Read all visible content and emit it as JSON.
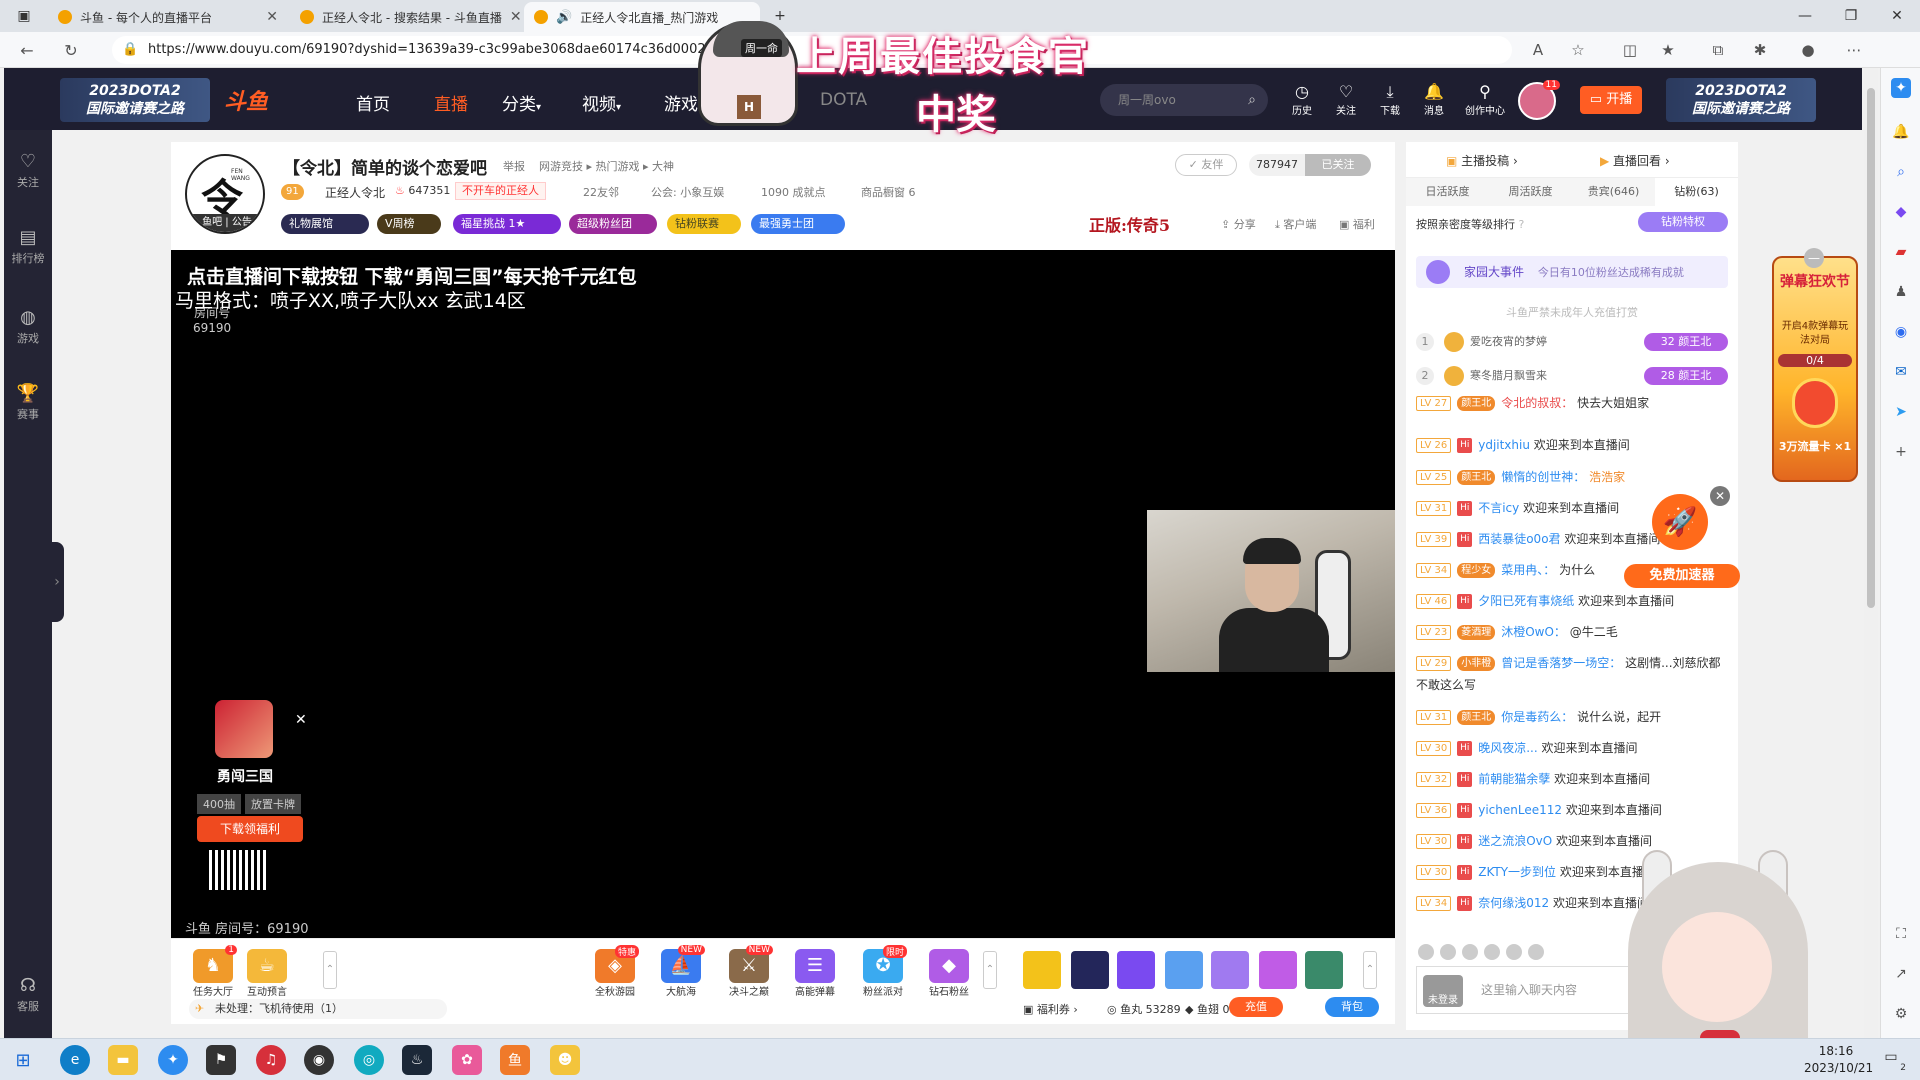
{
  "browser": {
    "tabs": [
      {
        "title": "斗鱼 - 每个人的直播平台",
        "active": false
      },
      {
        "title": "正经人令北 - 搜索结果 - 斗鱼直播",
        "active": false
      },
      {
        "title": "正经人令北直播_热门游戏",
        "active": true
      }
    ],
    "url": "https://www.douyu.com/69190?dyshid=13639a39-c3c99abe3068dae60174c36d0002160"
  },
  "promo": {
    "line1": "上周最佳投食官",
    "line2": "中奖",
    "badge": "周一命",
    "mark": "H"
  },
  "header": {
    "banner_left": [
      "2023DOTA2",
      "国际邀请赛之路"
    ],
    "banner_right": [
      "2023DOTA2",
      "国际邀请赛之路"
    ],
    "logo": "斗鱼",
    "nav": [
      "首页",
      "直播",
      "分类",
      "视频",
      "游戏",
      "DOTA"
    ],
    "search_placeholder": "周一周ovo",
    "icons": [
      {
        "icon": "history-icon",
        "label": "历史"
      },
      {
        "icon": "heart-icon",
        "label": "关注"
      },
      {
        "icon": "download-icon",
        "label": "下载"
      },
      {
        "icon": "bell-icon",
        "label": "消息"
      },
      {
        "icon": "bulb-icon",
        "label": "创作中心"
      }
    ],
    "avatar_badge": "11",
    "start_live": "开播"
  },
  "left_sidebar": [
    {
      "icon": "heart-icon",
      "label": "关注"
    },
    {
      "icon": "ranking-icon",
      "label": "排行榜"
    },
    {
      "icon": "game-icon",
      "label": "游戏"
    },
    {
      "icon": "trophy-icon",
      "label": "赛事"
    },
    {
      "icon": "service-icon",
      "label": "客服"
    }
  ],
  "room": {
    "avatar_char": "令王",
    "avatar_sub": "FEN WANG",
    "avatar_bar": "鱼吧 | 公告",
    "title": "【令北】简单的谈个恋爱吧",
    "report": "举报",
    "breadcrumb": "网游竞技 ▸ 热门游戏 ▸ 大神",
    "level": "91",
    "streamer": "正经人令北",
    "heat": "647351",
    "tagline": "不开车的正经人",
    "neighbors": "22友邻",
    "guild": "公会: 小象互娱",
    "achievements": "1090 成就点",
    "shop": "商品橱窗 6",
    "pills": [
      "礼物展馆",
      "V周榜",
      "福星挑战 1★",
      "超级粉丝团",
      "钻粉联赛",
      "最强勇士团"
    ],
    "right_brand": "正版:传奇5",
    "actions": [
      "分享",
      "客户端",
      "福利"
    ],
    "follow_btn": "✓ 友伴",
    "follow_count": "787947",
    "followed_btn": "已关注"
  },
  "video": {
    "banner": "点击直播间下载按钮 下载“勇闯三国”每天抢千元红包",
    "subtitle": "马里格式：喷子XX,喷子大队xx  玄武14区",
    "room_label": "房间号",
    "room_id": "69190",
    "bottom_tag": "斗鱼 房间号：69190",
    "ad": {
      "name": "勇闯三国",
      "tags": [
        "400抽",
        "放置卡牌"
      ],
      "download": "下载领福利"
    }
  },
  "toolbar": {
    "left_icons": [
      {
        "label": "任务大厅",
        "badge": "1",
        "color": "#f09a2a"
      },
      {
        "label": "互动预言",
        "badge": "",
        "color": "#f4b83a"
      }
    ],
    "mid_icons": [
      {
        "label": "全秋游园",
        "badge": "特惠",
        "color": "#f07a2a"
      },
      {
        "label": "大航海",
        "badge": "NEW",
        "color": "#3a7bf0"
      },
      {
        "label": "决斗之巅",
        "badge": "NEW",
        "color": "#8a6a4a"
      },
      {
        "label": "高能弹幕",
        "badge": "",
        "color": "#8a5af0"
      },
      {
        "label": "粉丝派对",
        "badge": "限时",
        "color": "#3aaaf0"
      },
      {
        "label": "钻石粉丝",
        "badge": "",
        "color": "#b05ce6"
      }
    ],
    "notice": "未处理：飞机待使用（1）",
    "welfare": "福利券",
    "fishball": "鱼丸 53289",
    "fishfin": "鱼翅 0.3",
    "recharge": "充值",
    "backpack": "背包"
  },
  "right_panel": {
    "top_links": [
      "主播投稿",
      "直播回看"
    ],
    "tabs": [
      "日活跃度",
      "周活跃度",
      "贵宾(646)",
      "钻粉(63)"
    ],
    "rank_header": "按照亲密度等级排行",
    "privilege": "钻粉特权",
    "event_title": "家园大事件",
    "event_sub": "今日有10位粉丝达成稀有成就",
    "warning": "斗鱼严禁未成年人充值打赏",
    "ranks": [
      {
        "n": "1",
        "name": "爱吃夜宵的梦婷",
        "fan": "32 颜王北"
      },
      {
        "n": "2",
        "name": "寒冬腊月飘雪来",
        "fan": "28 颜王北"
      }
    ],
    "chat": [
      {
        "lv": "LV 27",
        "fan": "颜王北",
        "user": "令北的叔叔：",
        "text": "快去大姐姐家"
      },
      {
        "lv": "LV 26",
        "fan": "",
        "user": "ydjitxhiu",
        "text": "欢迎来到本直播间"
      },
      {
        "lv": "LV 25",
        "fan": "颜王北",
        "user": "懒惰的创世神：",
        "text": "浩浩家"
      },
      {
        "lv": "LV 31",
        "fan": "",
        "user": "不言icy",
        "text": "欢迎来到本直播间"
      },
      {
        "lv": "LV 39",
        "fan": "",
        "user": "西装暴徒o0o君",
        "text": "欢迎来到本直播间"
      },
      {
        "lv": "LV 34",
        "fan": "程少女",
        "user": "菜用冉、：",
        "text": "为什么"
      },
      {
        "lv": "LV 46",
        "fan": "",
        "user": "夕阳已死有事烧纸",
        "text": "欢迎来到本直播间"
      },
      {
        "lv": "LV 23",
        "fan": "菱酒理",
        "user": "沐橙OwO：",
        "text": "@牛二毛"
      },
      {
        "lv": "LV 29",
        "fan": "小非橙",
        "user": "曾记是香落梦一场空：",
        "text": "这剧情...刘慈欣都不敢这么写"
      },
      {
        "lv": "LV 31",
        "fan": "颜王北",
        "user": "你是毒药么：",
        "text": "说什么说，起开"
      },
      {
        "lv": "LV 30",
        "fan": "",
        "user": "晚风夜凉...",
        "text": "欢迎来到本直播间"
      },
      {
        "lv": "LV 32",
        "fan": "",
        "user": "前朝能猫余孽",
        "text": "欢迎来到本直播间"
      },
      {
        "lv": "LV 36",
        "fan": "",
        "user": "yichenLee112",
        "text": "欢迎来到本直播间"
      },
      {
        "lv": "LV 30",
        "fan": "",
        "user": "迷之流浪OvO",
        "text": "欢迎来到本直播间"
      },
      {
        "lv": "LV 30",
        "fan": "",
        "user": "ZKTY一步到位",
        "text": "欢迎来到本直播间"
      },
      {
        "lv": "LV 34",
        "fan": "",
        "user": "奈何缘浅012",
        "text": "欢迎来到本直播间"
      }
    ],
    "unlogged": "未登录",
    "input_placeholder": "这里输入聊天内容"
  },
  "speedup": {
    "label": "免费加速器"
  },
  "festival": {
    "title": "弹幕狂欢节",
    "sub": "开启4款弹幕玩法对局",
    "progress": "0/4",
    "card": "3万流量卡 ×1"
  },
  "taskbar": {
    "time": "18:16",
    "date": "2023/10/21",
    "notif": "2"
  }
}
